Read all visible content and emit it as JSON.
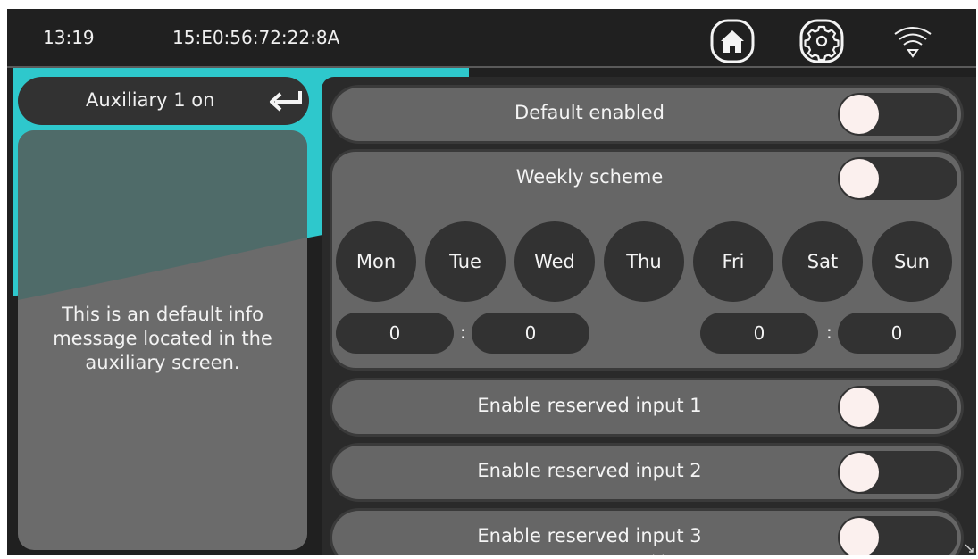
{
  "topbar": {
    "time": "13:19",
    "device_id": "15:E0:56:72:22:8A",
    "icons": [
      "home-icon",
      "settings-gear-icon",
      "wifi-icon"
    ]
  },
  "left": {
    "title": "Auxiliary 1 on",
    "back_icon": "return-arrow-icon",
    "info_message": "This is an default info message located in the auxiliary screen."
  },
  "settings": {
    "default_enabled": {
      "label": "Default enabled",
      "on": false
    },
    "weekly_scheme": {
      "label": "Weekly scheme",
      "on": false,
      "days": [
        "Mon",
        "Tue",
        "Wed",
        "Thu",
        "Fri",
        "Sat",
        "Sun"
      ],
      "start_hour": "0",
      "start_minute": "0",
      "end_hour": "0",
      "end_minute": "0",
      "separator": ":"
    },
    "reserved_inputs": [
      {
        "label": "Enable reserved input 1",
        "on": false
      },
      {
        "label": "Enable reserved input 2",
        "on": false
      },
      {
        "label": "Enable reserved input 3",
        "on": false
      }
    ]
  },
  "colors": {
    "accent": "#2ec8cc",
    "panel": "#666666",
    "dark": "#323232",
    "background": "#202020",
    "knob": "#fbf0ee"
  }
}
